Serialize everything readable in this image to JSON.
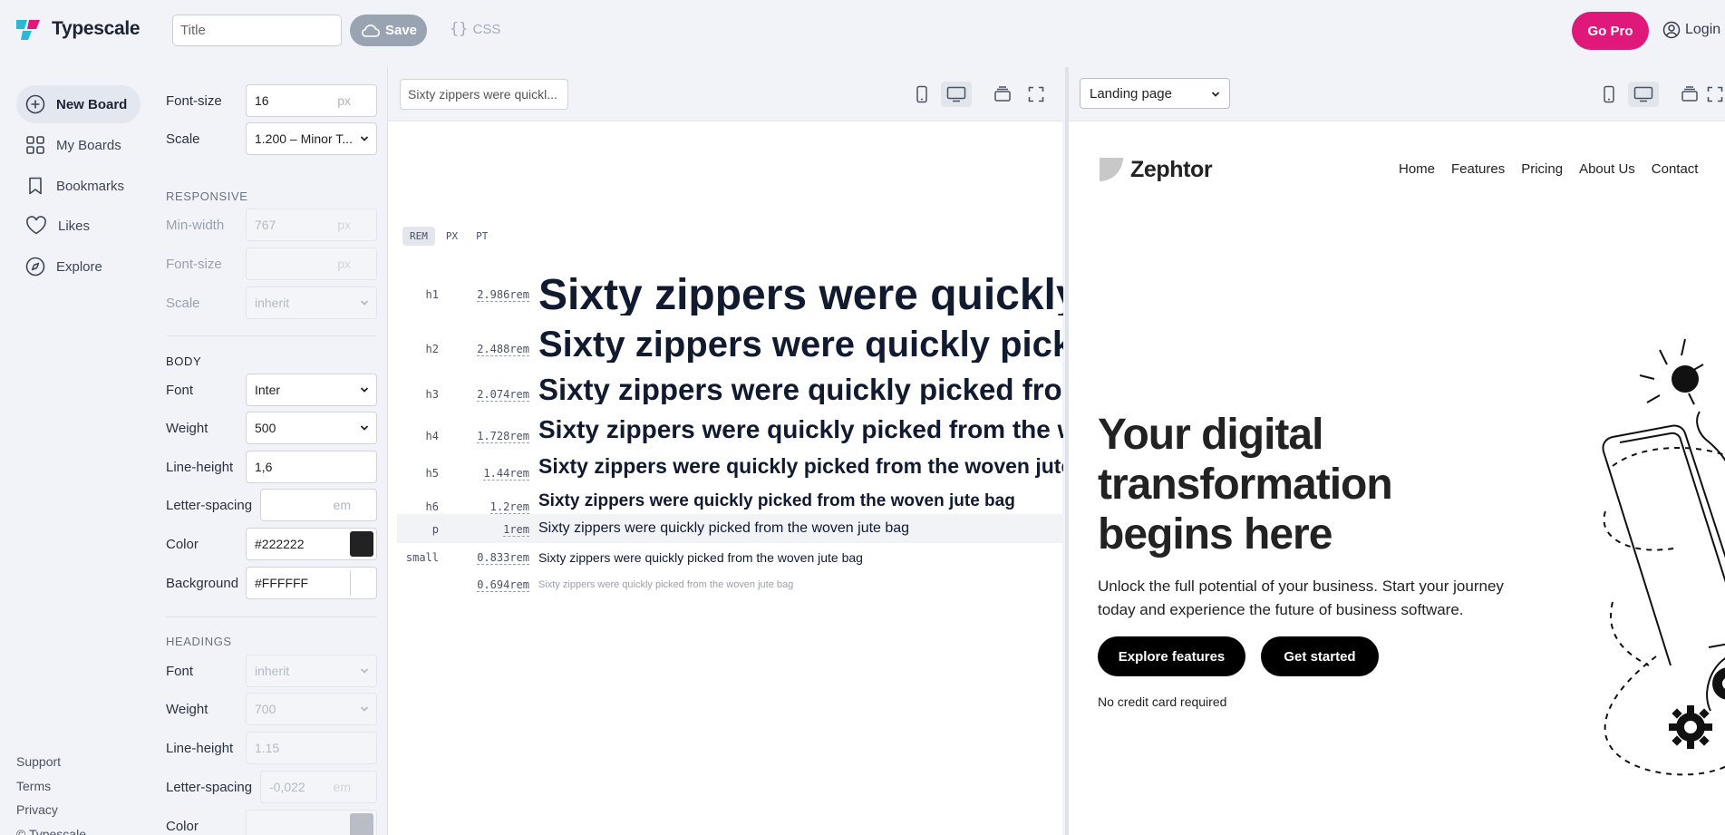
{
  "app": {
    "name": "Typescale",
    "title_placeholder": "Title",
    "save_label": "Save",
    "css_label": "CSS",
    "gopro_label": "Go Pro",
    "login_label": "Login"
  },
  "nav": {
    "items": [
      {
        "label": "New Board",
        "icon": "plus-circle-icon"
      },
      {
        "label": "My Boards",
        "icon": "grid-icon"
      },
      {
        "label": "Bookmarks",
        "icon": "bookmark-icon"
      },
      {
        "label": "Likes",
        "icon": "heart-icon"
      },
      {
        "label": "Explore",
        "icon": "compass-icon"
      }
    ],
    "footer": [
      "Support",
      "Terms",
      "Privacy",
      "© Typescale"
    ]
  },
  "settings": {
    "font_size_label": "Font-size",
    "font_size_value": "16",
    "font_size_unit": "px",
    "scale_label": "Scale",
    "scale_value": "1.200 – Minor T...",
    "responsive": {
      "title": "RESPONSIVE",
      "min_width_label": "Min-width",
      "min_width_value": "767",
      "min_width_unit": "px",
      "font_size_label": "Font-size",
      "font_size_unit": "px",
      "scale_label": "Scale",
      "scale_value": "inherit"
    },
    "body": {
      "title": "BODY",
      "font_label": "Font",
      "font_value": "Inter",
      "weight_label": "Weight",
      "weight_value": "500",
      "line_height_label": "Line-height",
      "line_height_value": "1,6",
      "letter_spacing_label": "Letter-spacing",
      "letter_spacing_unit": "em",
      "color_label": "Color",
      "color_value": "#222222",
      "background_label": "Background",
      "background_value": "#FFFFFF"
    },
    "headings": {
      "title": "HEADINGS",
      "font_label": "Font",
      "font_value": "inherit",
      "weight_label": "Weight",
      "weight_value": "700",
      "line_height_label": "Line-height",
      "line_height_value": "1.15",
      "letter_spacing_label": "Letter-spacing",
      "letter_spacing_value": "-0,022",
      "letter_spacing_unit": "em",
      "color_label": "Color"
    }
  },
  "preview": {
    "sample_text_value": "Sixty zippers were quickl...",
    "unit_tabs": [
      "REM",
      "PX",
      "PT"
    ],
    "sample": "Sixty zippers were quickly picked from the woven jute bag",
    "rows": [
      {
        "tag": "h1",
        "size": "2.986rem"
      },
      {
        "tag": "h2",
        "size": "2.488rem"
      },
      {
        "tag": "h3",
        "size": "2.074rem"
      },
      {
        "tag": "h4",
        "size": "1.728rem"
      },
      {
        "tag": "h5",
        "size": "1.44rem"
      },
      {
        "tag": "h6",
        "size": "1.2rem"
      },
      {
        "tag": "p",
        "size": "1rem"
      },
      {
        "tag": "small",
        "size": "0.833rem"
      },
      {
        "tag": "",
        "size": "0.694rem"
      }
    ]
  },
  "site": {
    "preset_value": "Landing page",
    "brand": "Zephtor",
    "menu": [
      "Home",
      "Features",
      "Pricing",
      "About Us",
      "Contact"
    ],
    "headline": "Your digital transformation begins here",
    "subtext": "Unlock the full potential of your business. Start your journey today and experience the future of business software.",
    "primary_cta": "Explore features",
    "secondary_cta": "Get started",
    "note": "No credit card required"
  },
  "colors": {
    "accent": "#E0187A",
    "body_color": "#222222",
    "background": "#FFFFFF"
  }
}
